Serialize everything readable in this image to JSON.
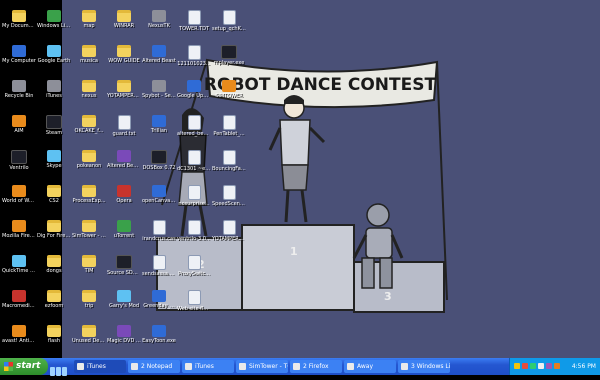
{
  "desktop": {
    "col1": [
      {
        "label": "My Documents",
        "icon": "folder-docs-icon",
        "cls": "folder"
      },
      {
        "label": "My Computer",
        "icon": "computer-icon",
        "cls": "app"
      },
      {
        "label": "Recycle Bin",
        "icon": "recycle-bin-icon",
        "cls": "gry"
      },
      {
        "label": "AIM",
        "icon": "aim-icon",
        "cls": "org"
      },
      {
        "label": "VentriIo",
        "icon": "ventrilo-icon",
        "cls": "dark"
      },
      {
        "label": "World of Warcraft",
        "icon": "wow-icon",
        "cls": "org"
      },
      {
        "label": "Mozilla Firefox",
        "icon": "firefox-icon",
        "cls": "org"
      },
      {
        "label": "QuickTime Player",
        "icon": "quicktime-icon",
        "cls": "blu2"
      },
      {
        "label": "Macromedia Flash 8",
        "icon": "flash-icon",
        "cls": "red"
      },
      {
        "label": "avast! Antivirus",
        "icon": "avast-icon",
        "cls": "org"
      }
    ],
    "col2": [
      {
        "label": "Windows Live Messenger",
        "icon": "messenger-icon",
        "cls": "grn"
      },
      {
        "label": "Google Earth",
        "icon": "google-earth-icon",
        "cls": "blu2"
      },
      {
        "label": "iTunes",
        "icon": "itunes-icon",
        "cls": "gry"
      },
      {
        "label": "Steam",
        "icon": "steam-icon",
        "cls": "dark"
      },
      {
        "label": "Skype",
        "icon": "skype-icon",
        "cls": "blu2"
      },
      {
        "label": "CS2",
        "icon": "folder-icon",
        "cls": "folder"
      },
      {
        "label": "Dig For Fire - a tribute to Pi...",
        "icon": "folder-icon",
        "cls": "folder"
      },
      {
        "label": "dongs",
        "icon": "folder-icon",
        "cls": "folder"
      },
      {
        "label": "ezfoom",
        "icon": "folder-icon",
        "cls": "folder"
      },
      {
        "label": "flash",
        "icon": "folder-icon",
        "cls": "folder"
      }
    ],
    "col3": [
      {
        "label": "map",
        "icon": "folder-icon",
        "cls": "folder"
      },
      {
        "label": "musica",
        "icon": "folder-icon",
        "cls": "folder"
      },
      {
        "label": "nexus",
        "icon": "folder-icon",
        "cls": "folder"
      },
      {
        "label": "OKCAKE_f...",
        "icon": "folder-icon",
        "cls": "folder"
      },
      {
        "label": "pokeanon",
        "icon": "folder-icon",
        "cls": "folder"
      },
      {
        "label": "ProcessExp...",
        "icon": "folder-icon",
        "cls": "folder"
      },
      {
        "label": "SimTower - The Verti...",
        "icon": "folder-icon",
        "cls": "folder"
      },
      {
        "label": "TIM",
        "icon": "folder-icon",
        "cls": "folder"
      },
      {
        "label": "trip",
        "icon": "folder-icon",
        "cls": "folder"
      },
      {
        "label": "Unused Deskto...",
        "icon": "folder-icon",
        "cls": "folder"
      }
    ],
    "col4": [
      {
        "label": "WINRAR",
        "icon": "folder-icon",
        "cls": "folder"
      },
      {
        "label": "WOW GUIDE",
        "icon": "folder-icon",
        "cls": "folder"
      },
      {
        "label": "YOTAMPERE...",
        "icon": "folder-icon",
        "cls": "folder"
      },
      {
        "label": "guard.txt",
        "icon": "text-file-icon",
        "cls": "file"
      },
      {
        "label": "Altered Beast on the Gam...",
        "icon": "game-icon",
        "cls": "pur"
      },
      {
        "label": "Opera",
        "icon": "opera-icon",
        "cls": "red"
      },
      {
        "label": "uTorrent",
        "icon": "utorrent-icon",
        "cls": "grn"
      },
      {
        "label": "Source SDK Base 2007",
        "icon": "source-sdk-icon",
        "cls": "dark"
      },
      {
        "label": "Garry's Mod",
        "icon": "garrys-mod-icon",
        "cls": "blu2"
      },
      {
        "label": "Magic DVD Ripper",
        "icon": "dvd-icon",
        "cls": "pur"
      }
    ],
    "col5": [
      {
        "label": "NexusTK",
        "icon": "nexustk-icon",
        "cls": "gry"
      },
      {
        "label": "Altered Beast",
        "icon": "game-icon",
        "cls": "app"
      },
      {
        "label": "Spybot - Searc...",
        "icon": "spybot-icon",
        "cls": "gry"
      },
      {
        "label": "Trillian",
        "icon": "trillian-icon",
        "cls": "app"
      },
      {
        "label": "DOSBox 0.72",
        "icon": "dosbox-icon",
        "cls": "dark"
      },
      {
        "label": "openCanvas Plus",
        "icon": "opencanvas-icon",
        "cls": "app"
      },
      {
        "label": "irandcrus.cas",
        "icon": "file-icon",
        "cls": "file"
      },
      {
        "label": "sendsassa.txt",
        "icon": "text-file-icon",
        "cls": "file"
      },
      {
        "label": "Greenday_...",
        "icon": "music-file-icon",
        "cls": "app"
      },
      {
        "label": "EasyToon.exe",
        "icon": "easytoon-icon",
        "cls": "app"
      }
    ],
    "col6": [
      {
        "label": "TOWER.TDT",
        "icon": "file-icon",
        "cls": "file"
      },
      {
        "label": "121101023...",
        "icon": "file-icon",
        "cls": "file"
      },
      {
        "label": "Google Updater.exe",
        "icon": "google-updater-icon",
        "cls": "app"
      },
      {
        "label": "altered_beast",
        "icon": "file-icon",
        "cls": "file"
      },
      {
        "label": "dC1301 ~exe",
        "icon": "file-icon",
        "cls": "file"
      },
      {
        "label": "nosurprise...",
        "icon": "file-icon",
        "cls": "file"
      },
      {
        "label": "ventrilo-3.0 ...",
        "icon": "file-icon",
        "cls": "file"
      },
      {
        "label": "ProxySwitc...",
        "icon": "file-icon",
        "cls": "file"
      },
      {
        "label": "Web site flow chart.vsc",
        "icon": "visio-icon",
        "cls": "file"
      }
    ],
    "col7": [
      {
        "label": "setup_qchKi...",
        "icon": "file-icon",
        "cls": "file"
      },
      {
        "label": "mplayer.exe",
        "icon": "mplayer-icon",
        "cls": "dark"
      },
      {
        "label": "SIMTOWER",
        "icon": "simtower-icon",
        "cls": "org"
      },
      {
        "label": "PenTablet_...",
        "icon": "file-icon",
        "cls": "file"
      },
      {
        "label": "BouncingFal...",
        "icon": "file-icon",
        "cls": "file"
      },
      {
        "label": "SpeedScene...",
        "icon": "file-icon",
        "cls": "file"
      },
      {
        "label": "YOTAMPERE...",
        "icon": "file-icon",
        "cls": "file"
      }
    ]
  },
  "wallpaper": {
    "banner_text": "ROBOT DANCE CONTEST",
    "podium_numbers": [
      "1",
      "2",
      "3"
    ],
    "colors": {
      "bg": "#4a5077",
      "podium": "#c9ccd6",
      "banner": "#e9e9e3"
    }
  },
  "taskbar": {
    "start_label": "start",
    "quick_launch": [
      "firefox-icon",
      "desktop-icon",
      "media-icon"
    ],
    "buttons": [
      {
        "label": "iTunes",
        "icon": "itunes-icon",
        "active": true
      },
      {
        "label": "2 Notepad",
        "icon": "notepad-icon",
        "active": false
      },
      {
        "label": "iTunes",
        "icon": "itunes-icon",
        "active": false
      },
      {
        "label": "SimTower - TOWER",
        "icon": "simtower-icon",
        "active": false
      },
      {
        "label": "2 Firefox",
        "icon": "firefox-icon",
        "active": false
      },
      {
        "label": "Away",
        "icon": "aim-icon",
        "active": false
      },
      {
        "label": "3 Windows Live ...",
        "icon": "messenger-icon",
        "active": false
      }
    ],
    "clock": "4:56 PM",
    "colors": {
      "bar": "#2557d1",
      "start": "#3a9c36",
      "tray": "#0f9ae8"
    }
  }
}
